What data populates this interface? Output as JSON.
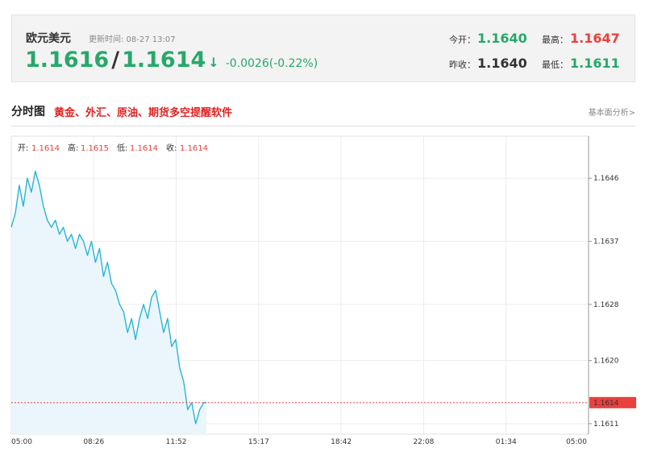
{
  "quote": {
    "name": "欧元美元",
    "time_label": "更新时间: 08-27 13:07",
    "bid": "1.1616",
    "ask": "1.1614",
    "arrow": "↓",
    "change": "-0.0026(-0.22%)",
    "open_label": "今开：",
    "open": "1.1640",
    "high_label": "最高：",
    "high": "1.1647",
    "prev_close_label": "昨收：",
    "prev_close": "1.1640",
    "low_label": "最低：",
    "low": "1.1611"
  },
  "section": {
    "title": "分时图",
    "promo": "黄金、外汇、原油、期货多空提醒软件",
    "link": "基本面分析>"
  },
  "ohlc": {
    "open_label": "开:",
    "open": "1.1614",
    "high_label": "高:",
    "high": "1.1615",
    "low_label": "低:",
    "low": "1.1614",
    "close_label": "收:",
    "close": "1.1614"
  },
  "colors": {
    "up": "#e8413e",
    "down": "#27a86b",
    "line": "#2ab4d6",
    "area": "#eaf6fb",
    "current_marker": "#e8413e"
  },
  "chart_data": {
    "type": "line",
    "x_start": "05:00",
    "x_end_next_day": "05:00",
    "x_ticks": [
      "05:00",
      "08:26",
      "11:52",
      "15:17",
      "18:42",
      "22:08",
      "01:34",
      "05:00"
    ],
    "y_ticks": [
      "1.1646",
      "1.1637",
      "1.1628",
      "1.1620",
      "1.1611"
    ],
    "ylim": [
      1.16095,
      1.1652
    ],
    "current_price": "1.1614",
    "grid": true,
    "series": [
      {
        "x": [
          "05:00",
          "05:10",
          "05:20",
          "05:30",
          "05:40",
          "05:50",
          "06:00",
          "06:10",
          "06:20",
          "06:30",
          "06:40",
          "06:50",
          "07:00",
          "07:10",
          "07:20",
          "07:30",
          "07:40",
          "07:50",
          "08:00",
          "08:10",
          "08:20",
          "08:30",
          "08:40",
          "08:50",
          "09:00",
          "09:10",
          "09:20",
          "09:30",
          "09:40",
          "09:50",
          "10:00",
          "10:10",
          "10:20",
          "10:30",
          "10:40",
          "10:50",
          "11:00",
          "11:10",
          "11:20",
          "11:30",
          "11:40",
          "11:50",
          "12:00",
          "12:10",
          "12:20",
          "12:30",
          "12:40",
          "12:50",
          "13:00",
          "13:07"
        ],
        "values": [
          1.1639,
          1.1641,
          1.1645,
          1.1642,
          1.1646,
          1.1644,
          1.1647,
          1.1645,
          1.1642,
          1.164,
          1.1639,
          1.164,
          1.1638,
          1.1639,
          1.1637,
          1.1638,
          1.1636,
          1.1638,
          1.1637,
          1.1635,
          1.1637,
          1.1634,
          1.1636,
          1.1632,
          1.1634,
          1.1631,
          1.163,
          1.1628,
          1.1627,
          1.1624,
          1.1626,
          1.1623,
          1.1626,
          1.1628,
          1.1626,
          1.1629,
          1.163,
          1.1627,
          1.1624,
          1.1626,
          1.1622,
          1.1623,
          1.1619,
          1.1617,
          1.1613,
          1.1614,
          1.1611,
          1.1613,
          1.1614,
          1.1614
        ]
      }
    ]
  }
}
